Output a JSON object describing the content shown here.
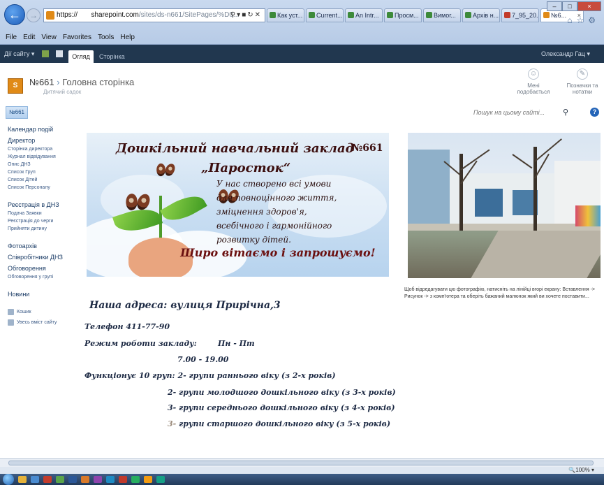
{
  "browser": {
    "url_host": "https://",
    "url_domain": "sharepoint.com",
    "url_path": "/sites/ds-n661/SitePages/%D0...",
    "tabs": [
      {
        "label": "Как уст..."
      },
      {
        "label": "Current..."
      },
      {
        "label": "An Intr..."
      },
      {
        "label": "Просм..."
      },
      {
        "label": "Вимог..."
      },
      {
        "label": "Архів н..."
      },
      {
        "label": "7_95_20..."
      },
      {
        "label": "№6..."
      }
    ],
    "menu": [
      "File",
      "Edit",
      "View",
      "Favorites",
      "Tools",
      "Help"
    ],
    "zoom": "100%"
  },
  "ribbon": {
    "site_actions": "Дії сайту",
    "tab_view": "Огляд",
    "tab_page": "Сторінка",
    "user": "Олександр Гац"
  },
  "header": {
    "logo": "S",
    "site": "№661",
    "separator": "›",
    "page": "Головна сторінка",
    "subtitle": "Дитячий садок",
    "like_label": "Мені подобається",
    "tags_label": "Позначки та нотатки"
  },
  "nav": {
    "home_tab": "№661",
    "search_placeholder": "Пошук на цьому сайті..."
  },
  "sidebar": {
    "calendar": "Календар подій",
    "director": "Директор",
    "director_links": [
      "Сторінка директора",
      "Журнал відвідування",
      "Опис ДНЗ",
      "Список Груп",
      "Список Дітей",
      "Список Персоналу"
    ],
    "registration": "Реєстрація в ДНЗ",
    "registration_links": [
      "Подача Заявки",
      "Реєстрація до черги",
      "Прийняти дитину"
    ],
    "photo_archive": "Фотоархів",
    "staff": "Співробітники ДНЗ",
    "discussions": "Обговорення",
    "discussions_link": "Обговорення у групі",
    "news": "Новини",
    "recycle_bin": "Кошик",
    "all_content": "Увесь вміст сайту"
  },
  "banner": {
    "title": "Дошкільний навчальний заклад",
    "number": "№661",
    "name": "„Паросток“",
    "lines": [
      "У нас створено всі умови",
      "для повноцінного життя,",
      "зміцнення здоров'я,",
      "всебічного і гармонійного",
      "розвитку дітей."
    ],
    "welcome": "Щиро вітаємо і запрошуємо!"
  },
  "photo_caption": "Щоб відредагувати цю фотографію, натисніть на лінійці вгорі екрану: Вставлення -> Рисунок -> з комп'ютера та оберіть бажаний малюнок який ви хочете поставити...",
  "info": {
    "address": "Наша адреса: вулиця Приріч­на,3",
    "phone": "Телефон 411-77-90",
    "hours_label": "Режим роботи закладу:",
    "hours_days": "Пн - Пт",
    "hours_time": "7.00 - 19.00",
    "groups_intro": "Функціонує 10 груп: 2- групи раннього віку (з 2-х років)",
    "group_2": "2- групи молодшого дошкільного віку (з 3-х років)",
    "group_3": "3- групи середнього дошкільного віку (з 4-х років)",
    "group_4_num": "3-",
    "group_4_text": "групи старшого дошкільного віку (з 5-х років)"
  },
  "colors": {
    "ribbon_bg": "#21374f",
    "accent_orange": "#e08a17",
    "link_blue": "#3b5a86"
  }
}
